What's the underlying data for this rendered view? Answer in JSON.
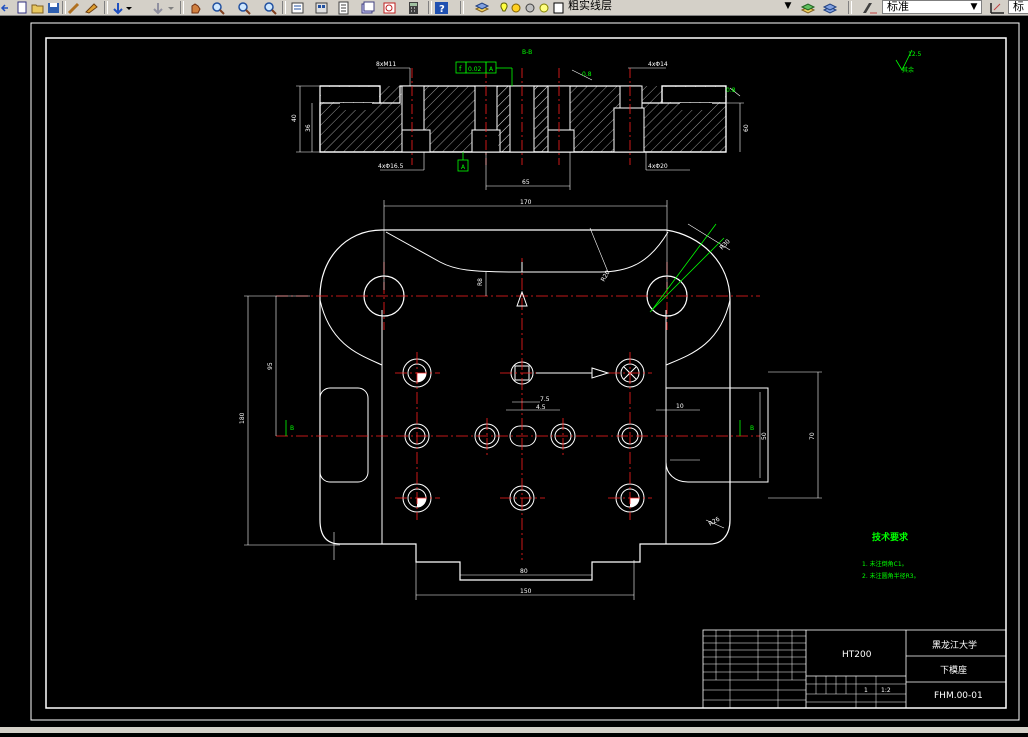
{
  "toolbar": {
    "layer_name": "粗实线层",
    "style_name": "标准",
    "style_name_2": "标"
  },
  "drawing": {
    "section_label": "B-B",
    "dim_top_left": "8xM11",
    "dim_top_mid": "0.02",
    "dim_top_right": "4xΦ14",
    "dim_bottom_left": "4xΦ16.5",
    "dim_bottom_right": "4xΦ20",
    "dim_65": "65",
    "dim_left_a": "40",
    "dim_left_b": "36",
    "dim_right_a": "60",
    "dim_170": "170",
    "dim_80": "80",
    "dim_150": "150",
    "dim_180": "180",
    "dim_95": "95",
    "dim_10": "10",
    "dim_70": "70",
    "dim_50": "50",
    "dim_R8": "R8",
    "dim_R20": "R20",
    "dim_R30": "R30",
    "dim_R26": "R26",
    "dim_75": "7.5",
    "dim_45": "4.5",
    "label_B_left": "B",
    "label_B_right": "B",
    "rough_top": "12.5",
    "rough_label": "其余",
    "rough_1": "0.8",
    "rough_2": "0.8",
    "tech_title": "技术要求",
    "tech_1": "1. 未注倒角C1。",
    "tech_2": "2. 未注圆角半径R3。"
  },
  "title_block": {
    "material": "HT200",
    "school": "黑龙江大学",
    "part_name": "下模座",
    "drawing_no": "FHM.00-01",
    "scale": "1:2",
    "count": "1"
  }
}
